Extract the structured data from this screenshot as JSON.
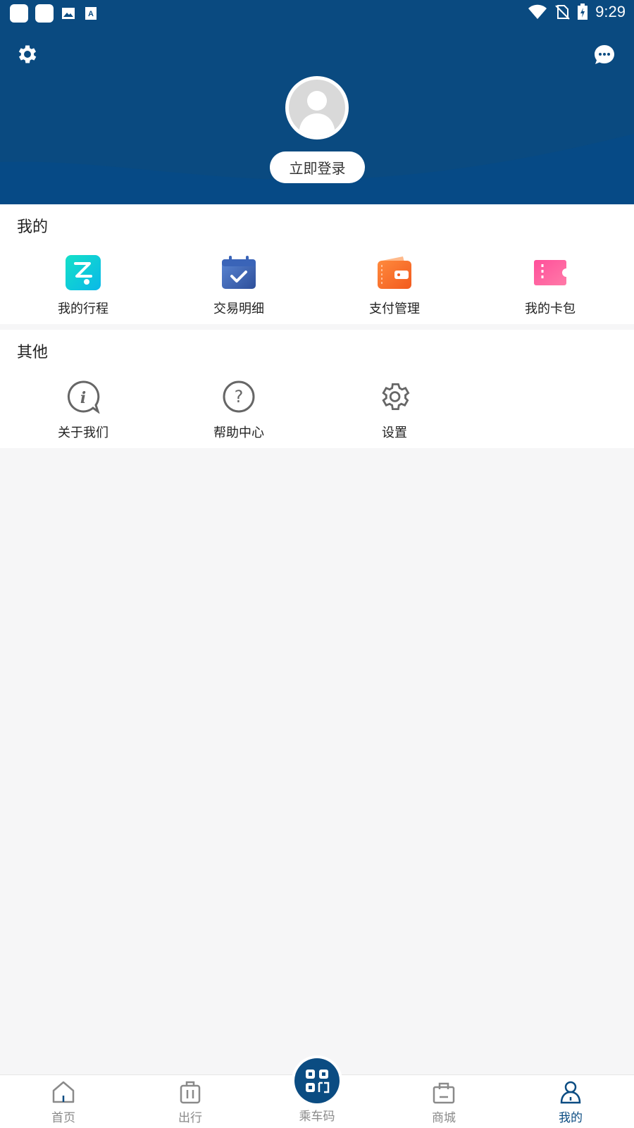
{
  "status_bar": {
    "time": "9:29"
  },
  "header": {
    "login_button": "立即登录"
  },
  "colors": {
    "primary": "#0b4c82",
    "background": "#f6f6f7"
  },
  "sections": [
    {
      "title": "我的",
      "items": [
        {
          "label": "我的行程",
          "icon": "trip-icon"
        },
        {
          "label": "交易明细",
          "icon": "calendar-check-icon"
        },
        {
          "label": "支付管理",
          "icon": "wallet-icon"
        },
        {
          "label": "我的卡包",
          "icon": "card-ticket-icon"
        }
      ]
    },
    {
      "title": "其他",
      "items": [
        {
          "label": "关于我们",
          "icon": "info-icon"
        },
        {
          "label": "帮助中心",
          "icon": "help-icon"
        },
        {
          "label": "设置",
          "icon": "gear-icon"
        }
      ]
    }
  ],
  "tabbar": {
    "tabs": [
      {
        "label": "首页",
        "icon": "home-icon"
      },
      {
        "label": "出行",
        "icon": "luggage-icon"
      },
      {
        "label": "乘车码",
        "icon": "qr-code-icon"
      },
      {
        "label": "商城",
        "icon": "shopping-bag-icon"
      },
      {
        "label": "我的",
        "icon": "person-icon",
        "active": true
      }
    ]
  }
}
